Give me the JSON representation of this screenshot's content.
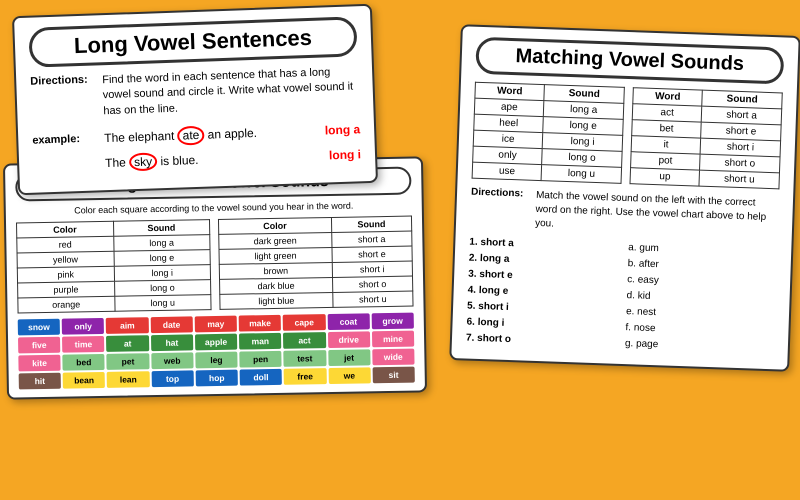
{
  "page": {
    "background_color": "#F5A623"
  },
  "worksheet_long_vowel": {
    "title": "Long Vowel Sentences",
    "directions_label": "Directions:",
    "directions_text": "Find the word in each sentence that has a long vowel sound and circle it.  Write what vowel sound it has on the line.",
    "example_label": "example:",
    "example1_pre": "The elephant ",
    "example1_circled": "ate",
    "example1_post": " an apple.",
    "example1_answer": "long a",
    "example2_pre": "The ",
    "example2_circled": "sky",
    "example2_post": " is blue.",
    "example2_answer": "long i"
  },
  "worksheet_vowel_sounds": {
    "title": "Long and Short Vowel Sounds",
    "sub_directions": "Color each square according to the vowel sound you hear in the word.",
    "table1_headers": [
      "Color",
      "Sound"
    ],
    "table1_rows": [
      [
        "red",
        "long a"
      ],
      [
        "yellow",
        "long e"
      ],
      [
        "pink",
        "long i"
      ],
      [
        "purple",
        "long o"
      ],
      [
        "orange",
        "long u"
      ]
    ],
    "table2_headers": [
      "Color",
      "Sound"
    ],
    "table2_rows": [
      [
        "dark green",
        "short a"
      ],
      [
        "light green",
        "short e"
      ],
      [
        "brown",
        "short i"
      ],
      [
        "dark blue",
        "short o"
      ],
      [
        "light blue",
        "short u"
      ]
    ],
    "grid_rows": [
      [
        {
          "text": "snow",
          "color": "cell-darkblue"
        },
        {
          "text": "only",
          "color": "cell-purple"
        },
        {
          "text": "aim",
          "color": "cell-red"
        },
        {
          "text": "date",
          "color": "cell-red"
        },
        {
          "text": "may",
          "color": "cell-red"
        },
        {
          "text": "make",
          "color": "cell-red"
        },
        {
          "text": "cape",
          "color": "cell-red"
        },
        {
          "text": "coat",
          "color": "cell-purple"
        },
        {
          "text": "grow",
          "color": "cell-purple"
        }
      ],
      [
        {
          "text": "five",
          "color": "cell-pink"
        },
        {
          "text": "time",
          "color": "cell-pink"
        },
        {
          "text": "at",
          "color": "cell-darkgreen"
        },
        {
          "text": "hat",
          "color": "cell-darkgreen"
        },
        {
          "text": "apple",
          "color": "cell-darkgreen"
        },
        {
          "text": "man",
          "color": "cell-darkgreen"
        },
        {
          "text": "act",
          "color": "cell-darkgreen"
        },
        {
          "text": "drive",
          "color": "cell-pink"
        },
        {
          "text": "mine",
          "color": "cell-pink"
        }
      ],
      [
        {
          "text": "kite",
          "color": "cell-pink"
        },
        {
          "text": "bed",
          "color": "cell-lightgreen"
        },
        {
          "text": "pet",
          "color": "cell-lightgreen"
        },
        {
          "text": "web",
          "color": "cell-lightgreen"
        },
        {
          "text": "leg",
          "color": "cell-lightgreen"
        },
        {
          "text": "pen",
          "color": "cell-lightgreen"
        },
        {
          "text": "test",
          "color": "cell-lightgreen"
        },
        {
          "text": "jet",
          "color": "cell-lightgreen"
        },
        {
          "text": "wide",
          "color": "cell-pink"
        }
      ],
      [
        {
          "text": "hit",
          "color": "cell-brown"
        },
        {
          "text": "bean",
          "color": "cell-yellow"
        },
        {
          "text": "lean",
          "color": "cell-yellow"
        },
        {
          "text": "top",
          "color": "cell-darkblue"
        },
        {
          "text": "hop",
          "color": "cell-darkblue"
        },
        {
          "text": "doll",
          "color": "cell-darkblue"
        },
        {
          "text": "free",
          "color": "cell-yellow"
        },
        {
          "text": "we",
          "color": "cell-yellow"
        },
        {
          "text": "sit",
          "color": "cell-brown"
        }
      ]
    ]
  },
  "worksheet_matching": {
    "title": "Matching Vowel Sounds",
    "table1_headers": [
      "Word",
      "Sound"
    ],
    "table1_rows": [
      [
        "ape",
        "long a"
      ],
      [
        "heel",
        "long e"
      ],
      [
        "ice",
        "long i"
      ],
      [
        "only",
        "long o"
      ],
      [
        "use",
        "long u"
      ]
    ],
    "table2_headers": [
      "Word",
      "Sound"
    ],
    "table2_rows": [
      [
        "act",
        "short a"
      ],
      [
        "bet",
        "short e"
      ],
      [
        "it",
        "short i"
      ],
      [
        "pot",
        "short o"
      ],
      [
        "up",
        "short u"
      ]
    ],
    "directions_label": "Directions:",
    "directions_text": "Match the vowel sound on the left with the correct word on the right.  Use the vowel chart above to help you.",
    "left_items": [
      "1.  short a",
      "2.  long a",
      "3.  short e",
      "4.  long e",
      "5.  short i",
      "6.  long i",
      "7.  short o"
    ],
    "right_items": [
      "a.  gum",
      "b.  after",
      "c.  easy",
      "d.  kid",
      "e.  nest",
      "f.  nose",
      "g.  page"
    ]
  }
}
